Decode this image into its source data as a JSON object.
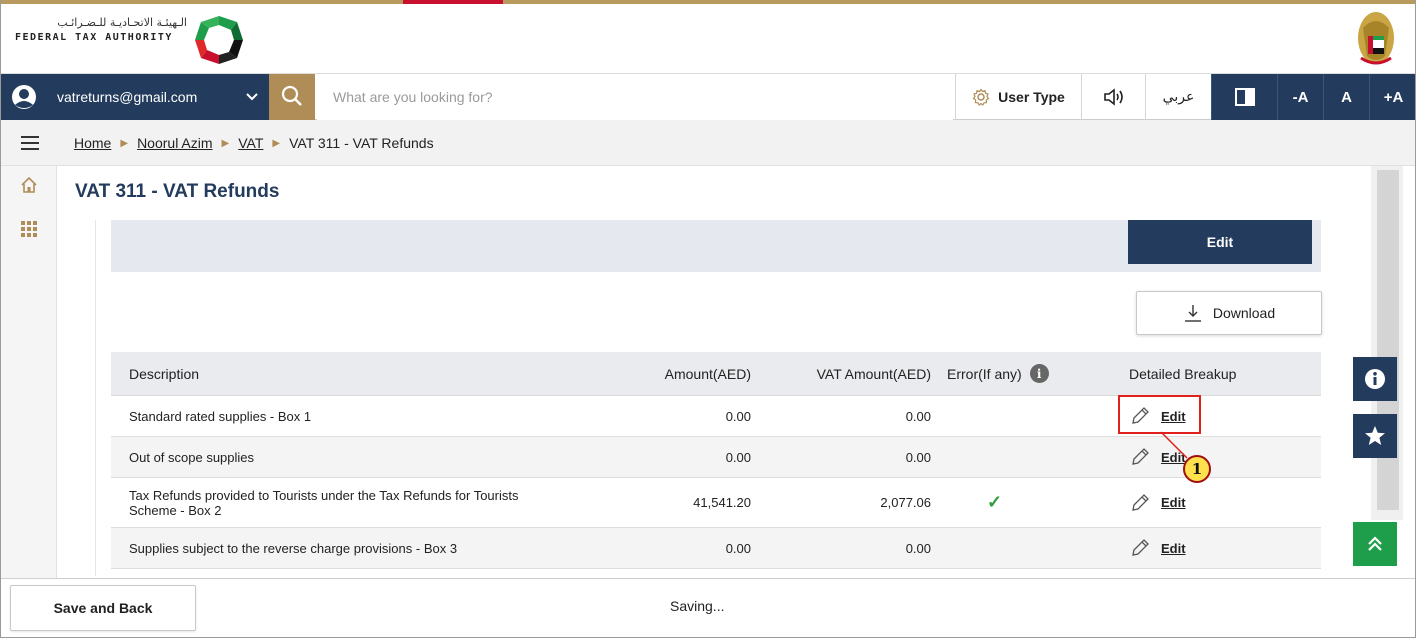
{
  "branding": {
    "arabic_name": "الـهيئـة الاتحـاديـة للـضـرائـب",
    "english_name": "FEDERAL TAX AUTHORITY"
  },
  "nav": {
    "user_email": "vatreturns@gmail.com",
    "search_placeholder": "What are you looking for?",
    "user_type_label": "User Type",
    "language_label": "عربي",
    "font_decrease": "-A",
    "font_normal": "A",
    "font_increase": "+A"
  },
  "breadcrumb": {
    "items": [
      "Home",
      "Noorul Azim",
      "VAT"
    ],
    "current": "VAT 311 - VAT Refunds"
  },
  "page": {
    "title": "VAT 311 - VAT Refunds",
    "edit_button": "Edit",
    "download_button": "Download"
  },
  "table": {
    "headers": {
      "description": "Description",
      "amount": "Amount(AED)",
      "vat_amount": "VAT Amount(AED)",
      "error": "Error(If any)",
      "breakup": "Detailed Breakup"
    },
    "rows": [
      {
        "description": "Standard rated supplies - Box 1",
        "amount": "0.00",
        "vat_amount": "0.00",
        "error": "",
        "action": "Edit"
      },
      {
        "description": "Out of scope supplies",
        "amount": "0.00",
        "vat_amount": "0.00",
        "error": "",
        "action": "Edit"
      },
      {
        "description": "Tax Refunds provided to Tourists under the Tax Refunds for Tourists Scheme - Box 2",
        "amount": "41,541.20",
        "vat_amount": "2,077.06",
        "error": "✓",
        "action": "Edit"
      },
      {
        "description": "Supplies subject to the reverse charge provisions - Box 3",
        "amount": "0.00",
        "vat_amount": "0.00",
        "error": "",
        "action": "Edit"
      }
    ]
  },
  "annotation": {
    "step_number": "1"
  },
  "footer": {
    "save_back": "Save and Back",
    "status": "Saving..."
  },
  "colors": {
    "navy": "#233b5c",
    "gold": "#b08d57",
    "green": "#1e9e4a",
    "highlight_red": "#e0201b"
  }
}
